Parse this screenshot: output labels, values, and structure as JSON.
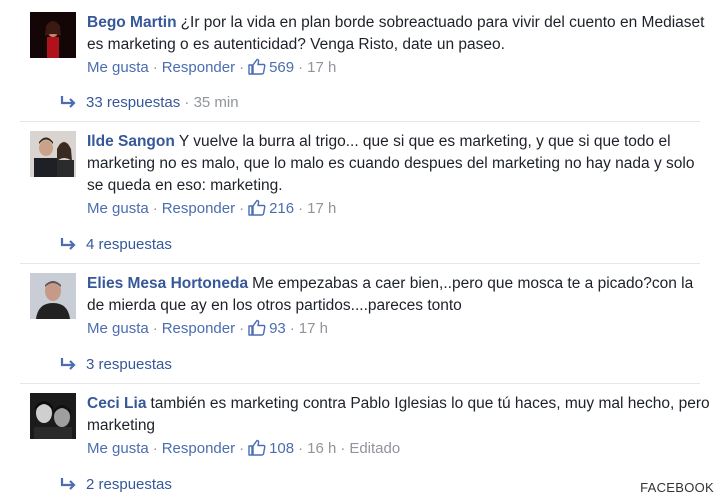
{
  "comments": [
    {
      "author": "Bego Martin",
      "text": "¿Ir por la vida en plan borde sobreactuado para vivir del cuento en Mediaset es marketing o es autenticidad? Venga Risto, date un paseo.",
      "like_label": "Me gusta",
      "reply_label": "Responder",
      "likes": "569",
      "time": "17 h",
      "edited": "",
      "replies_label": "33 respuestas",
      "replies_time": "35 min"
    },
    {
      "author": "Ilde Sangon",
      "text": "Y vuelve la burra al trigo... que si que es marketing, y que si que todo el marketing no es malo, que lo malo es cuando despues del marketing no hay nada y solo se queda en eso: marketing.",
      "like_label": "Me gusta",
      "reply_label": "Responder",
      "likes": "216",
      "time": "17 h",
      "edited": "",
      "replies_label": "4 respuestas",
      "replies_time": ""
    },
    {
      "author": "Elies Mesa Hortoneda",
      "text": "Me empezabas a caer bien,..pero que mosca te a picado?con la de mierda que ay en los otros partidos....pareces tonto",
      "like_label": "Me gusta",
      "reply_label": "Responder",
      "likes": "93",
      "time": "17 h",
      "edited": "",
      "replies_label": "3 respuestas",
      "replies_time": ""
    },
    {
      "author": "Ceci Lia",
      "text": "también es marketing contra Pablo Iglesias lo que tú haces, muy mal hecho, pero marketing",
      "like_label": "Me gusta",
      "reply_label": "Responder",
      "likes": "108",
      "time": "16 h",
      "edited": "Editado",
      "replies_label": "2 respuestas",
      "replies_time": ""
    }
  ],
  "watermark": "FACEBOOK",
  "colors": {
    "author": "#365899",
    "link": "#4b6db1",
    "meta": "#90949c",
    "text": "#1d2129"
  }
}
